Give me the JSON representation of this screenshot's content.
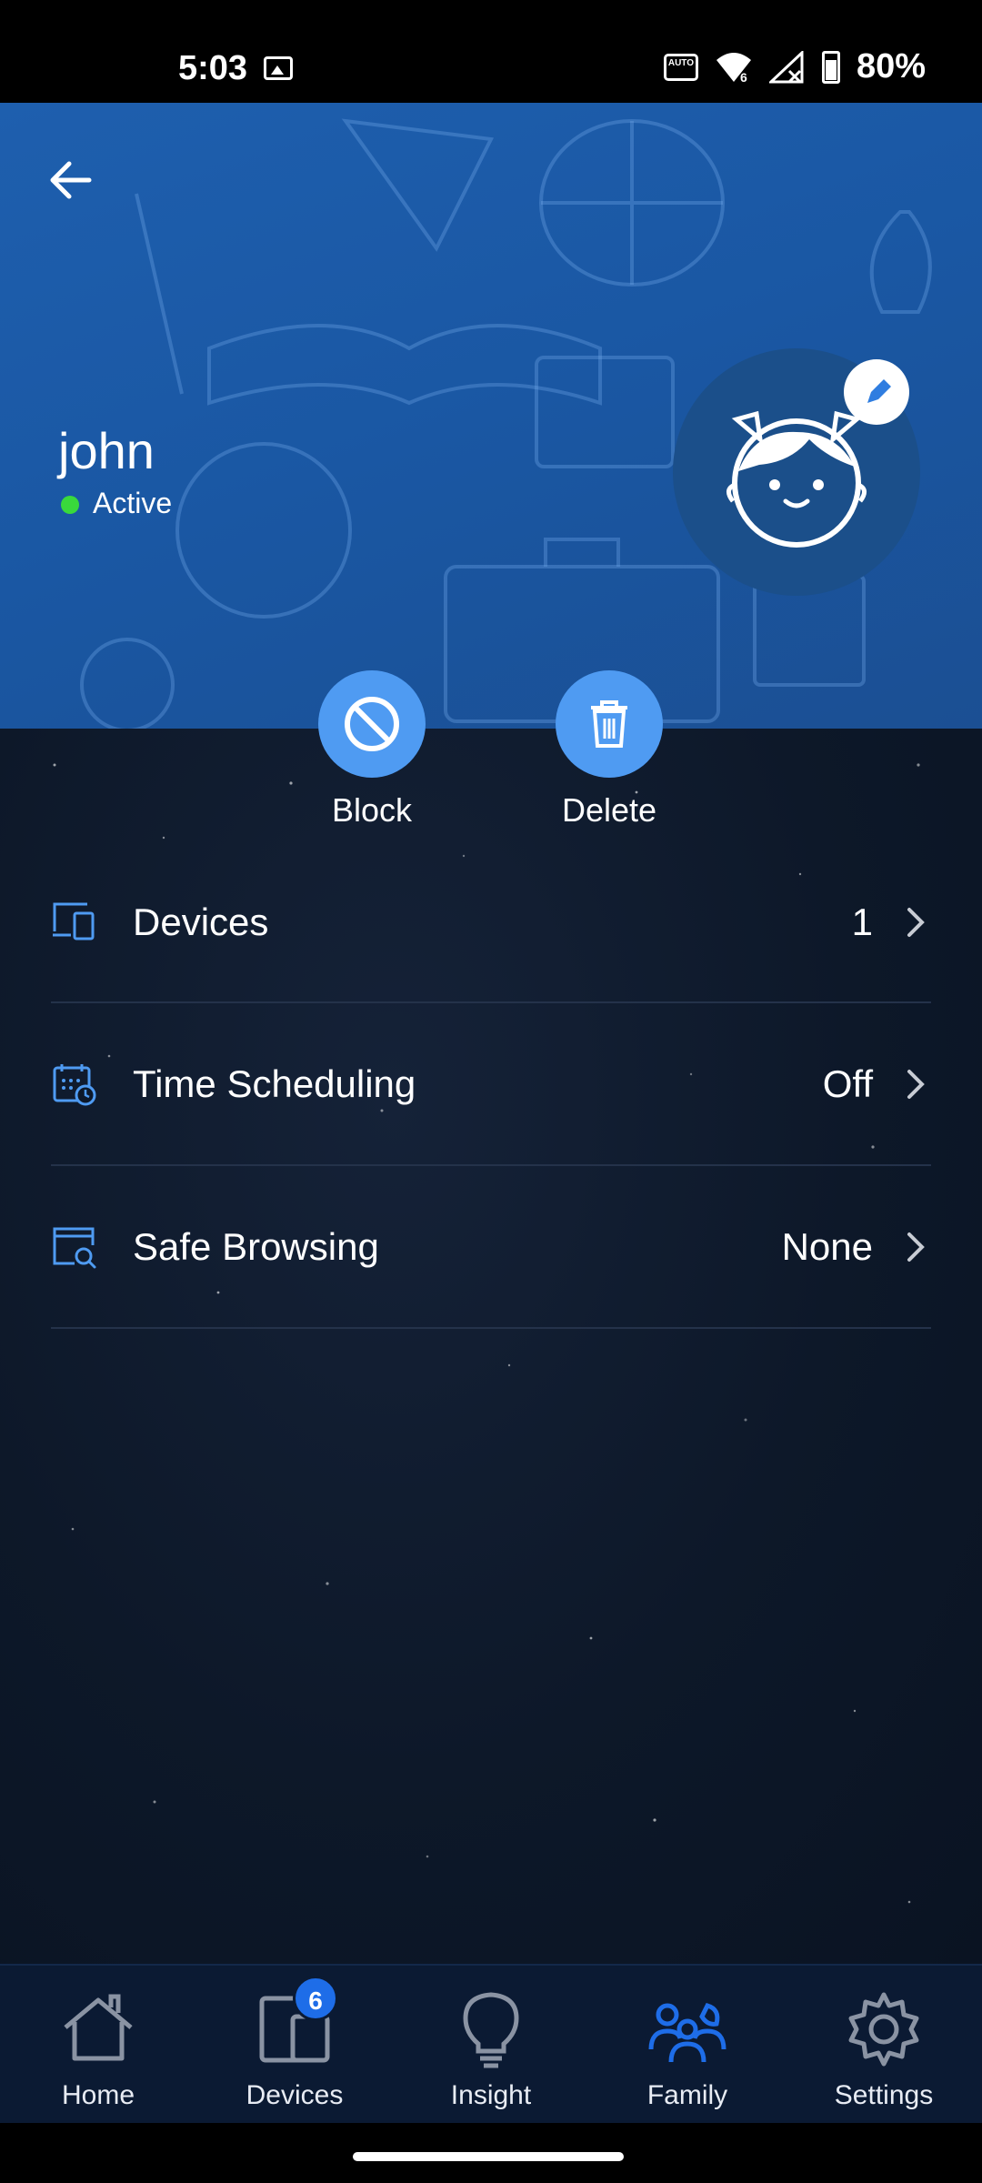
{
  "status_bar": {
    "time": "5:03",
    "battery_percent": "80%",
    "auto_label": "AUTO"
  },
  "profile": {
    "name": "john",
    "status": "Active",
    "status_color": "#39d93c"
  },
  "actions": [
    {
      "label": "Block",
      "icon": "block-icon"
    },
    {
      "label": "Delete",
      "icon": "trash-icon"
    }
  ],
  "menu": [
    {
      "label": "Devices",
      "value": "1",
      "icon": "devices-icon"
    },
    {
      "label": "Time Scheduling",
      "value": "Off",
      "icon": "calendar-clock-icon"
    },
    {
      "label": "Safe Browsing",
      "value": "None",
      "icon": "browser-search-icon"
    }
  ],
  "bottom_nav": {
    "items": [
      {
        "label": "Home",
        "icon": "home-icon"
      },
      {
        "label": "Devices",
        "icon": "devices-icon",
        "badge": "6"
      },
      {
        "label": "Insight",
        "icon": "lightbulb-icon"
      },
      {
        "label": "Family",
        "icon": "family-icon",
        "active": true
      },
      {
        "label": "Settings",
        "icon": "gear-icon"
      }
    ]
  },
  "colors": {
    "accent": "#4f9bf2",
    "hero_bg": "#1a57a3",
    "active_nav": "#1e6de8",
    "nav_bg": "#0b1a33"
  }
}
